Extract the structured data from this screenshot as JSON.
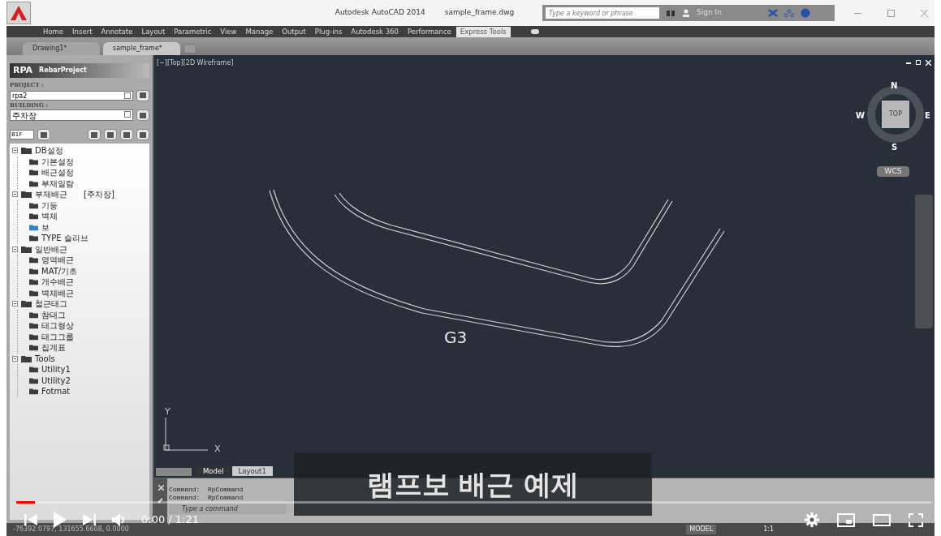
{
  "title_bar": {
    "app_title": "Autodesk AutoCAD 2014",
    "file_name": "sample_frame.dwg",
    "search_placeholder": "Type a keyword or phrase",
    "sign_in": "Sign In"
  },
  "ribbon_tabs": [
    {
      "label": "Home",
      "selected": false
    },
    {
      "label": "Insert",
      "selected": false
    },
    {
      "label": "Annotate",
      "selected": false
    },
    {
      "label": "Layout",
      "selected": false
    },
    {
      "label": "Parametric",
      "selected": false
    },
    {
      "label": "View",
      "selected": false
    },
    {
      "label": "Manage",
      "selected": false
    },
    {
      "label": "Output",
      "selected": false
    },
    {
      "label": "Plug-ins",
      "selected": false
    },
    {
      "label": "Autodesk 360",
      "selected": false
    },
    {
      "label": "Performance",
      "selected": false
    },
    {
      "label": "Express Tools",
      "selected": true
    }
  ],
  "file_tabs": [
    {
      "label": "Drawing1*",
      "selected": false
    },
    {
      "label": "sample_frame*",
      "selected": true
    }
  ],
  "palette": {
    "logo": "RPA",
    "title": "RebarProject",
    "project_label": "PROJECT :",
    "project_value": "rpa2",
    "building_label": "BUILDING :",
    "building_value": "주차장",
    "floor": "B1F",
    "tree": [
      {
        "label": "DB설정",
        "expanded": true,
        "selected": false,
        "children": [
          {
            "label": "기본설정",
            "selected": false
          },
          {
            "label": "배근설정",
            "selected": false
          },
          {
            "label": "부재일람",
            "selected": false
          }
        ]
      },
      {
        "label": "부재배근",
        "tag": "[주차장]",
        "expanded": true,
        "selected": false,
        "children": [
          {
            "label": "기둥",
            "selected": false
          },
          {
            "label": "벽체",
            "selected": false
          },
          {
            "label": "보",
            "selected": true
          },
          {
            "label": "TYPE 슬라브",
            "selected": false
          }
        ]
      },
      {
        "label": "일반배근",
        "expanded": true,
        "selected": false,
        "children": [
          {
            "label": "영역배근",
            "selected": false
          },
          {
            "label": "MAT/기초",
            "selected": false
          },
          {
            "label": "개수배근",
            "selected": false
          },
          {
            "label": "벽체배근",
            "selected": false
          }
        ]
      },
      {
        "label": "철근태그",
        "expanded": true,
        "selected": false,
        "children": [
          {
            "label": "참태그",
            "selected": false
          },
          {
            "label": "태그형상",
            "selected": false
          },
          {
            "label": "태그그룹",
            "selected": false
          },
          {
            "label": "집계표",
            "selected": false
          }
        ]
      },
      {
        "label": "Tools",
        "expanded": true,
        "selected": false,
        "children": [
          {
            "label": "Utility1",
            "selected": false
          },
          {
            "label": "Utility2",
            "selected": false
          },
          {
            "label": "Fotmat",
            "selected": false
          }
        ]
      }
    ]
  },
  "viewport": {
    "label": "[−][Top][2D Wireframe]",
    "compass": {
      "north": "N",
      "south": "S",
      "east": "E",
      "west": "W",
      "face": "TOP",
      "ucs": "WCS"
    },
    "drawing_label": "G3",
    "axis_y": "Y",
    "axis_x": "X"
  },
  "layout_tabs": [
    {
      "label": "Model",
      "selected": true
    },
    {
      "label": "Layout1",
      "selected": false
    }
  ],
  "command": {
    "history": [
      "Command:  RpCommand",
      "Command:  RpCommand"
    ],
    "placeholder": "Type a command"
  },
  "status_bar": {
    "coordinates": "-76392.0797, 131655.6608, 0.0000",
    "space": "MODEL",
    "scale": "1:1"
  },
  "video": {
    "caption": "램프보 배근 예제",
    "time": "0:00 / 1:21",
    "level": 0.02
  }
}
